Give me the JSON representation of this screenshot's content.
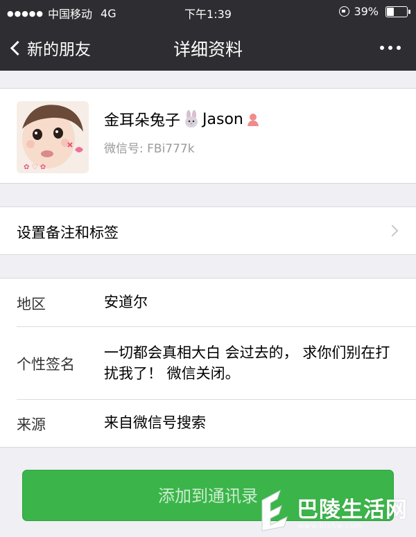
{
  "status_bar": {
    "signal": "●●●●●",
    "carrier": "中国移动",
    "network": "4G",
    "time": "下午1:39",
    "battery_percent": "39%",
    "battery_level": 0.39
  },
  "nav": {
    "back_label": "新的朋友",
    "title": "详细资料",
    "more_icon": "more-icon"
  },
  "profile": {
    "name_part1": "金耳朵兔子",
    "name_part2": "Jason",
    "wechat_id": "微信号: FBi777k",
    "gender_color": "#f08b8b"
  },
  "remark": {
    "label": "设置备注和标签"
  },
  "info": {
    "region_label": "地区",
    "region_value": "安道尔",
    "signature_label": "个性签名",
    "signature_value": " 一切都会真相大白 会过去的， 求你们别在打扰我了！ 微信关闭。",
    "source_label": "来源",
    "source_value": "来自微信号搜索"
  },
  "actions": {
    "add_label": "添加到通讯录"
  },
  "watermark": {
    "text": "巴陵生活网",
    "url": "www.blshw.com"
  },
  "colors": {
    "nav_bg": "#2e2e32",
    "page_bg": "#efeff4",
    "button_green": "#3bb54a"
  }
}
